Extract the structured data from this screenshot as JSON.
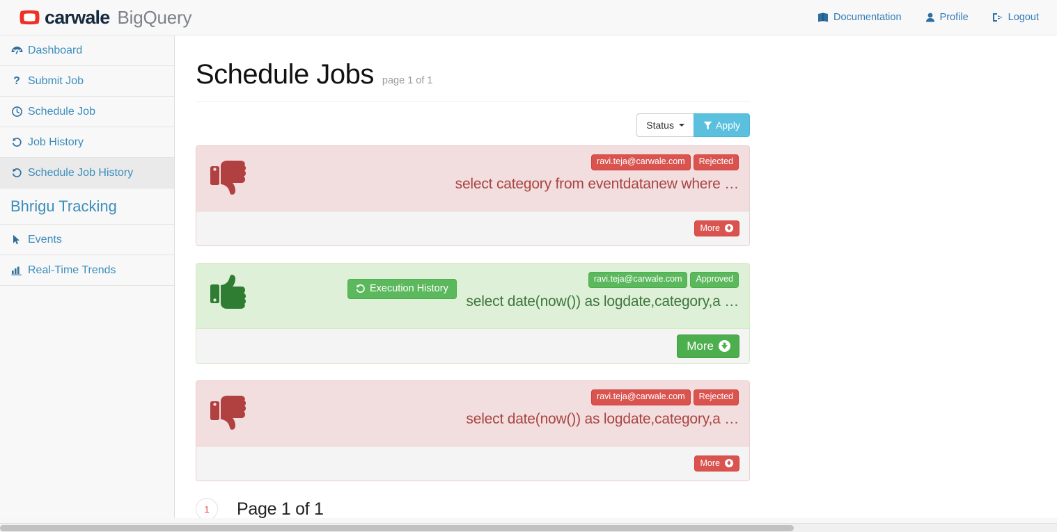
{
  "navbar": {
    "brand_word": "carwale",
    "brand_sub": "BigQuery",
    "logo_icon": "carwale-car-logo",
    "links": [
      {
        "label": "Documentation",
        "icon": "book-icon"
      },
      {
        "label": "Profile",
        "icon": "user-icon"
      },
      {
        "label": "Logout",
        "icon": "sign-out-icon"
      }
    ]
  },
  "sidebar": {
    "items": [
      {
        "label": "Dashboard",
        "icon": "dashboard-icon",
        "active": false
      },
      {
        "label": "Submit Job",
        "icon": "question-icon",
        "active": false
      },
      {
        "label": "Schedule Job",
        "icon": "clock-icon",
        "active": false
      },
      {
        "label": "Job History",
        "icon": "history-icon",
        "active": false
      },
      {
        "label": "Schedule Job History",
        "icon": "history-icon",
        "active": true
      }
    ],
    "section_heading": "Bhrigu Tracking",
    "tracking_items": [
      {
        "label": "Events",
        "icon": "cursor-icon"
      },
      {
        "label": "Real-Time Trends",
        "icon": "bar-chart-icon"
      }
    ]
  },
  "main": {
    "title": "Schedule Jobs",
    "subtitle": "page 1 of 1",
    "filter": {
      "status_label": "Status",
      "apply_label": "Apply",
      "filter_icon": "funnel-icon",
      "caret_icon": "caret-down-icon"
    },
    "cards": [
      {
        "status": "Rejected",
        "theme": "red",
        "thumb_icon": "thumbs-down-icon",
        "owner": "ravi.teja@carwale.com",
        "query": "select category from eventdatanew where …",
        "more_label": "More",
        "more_icon": "arrow-circle-down-icon",
        "has_execution_history": false,
        "execution_history_label": "",
        "execution_history_icon": ""
      },
      {
        "status": "Approved",
        "theme": "green",
        "thumb_icon": "thumbs-up-icon",
        "owner": "ravi.teja@carwale.com",
        "query": "select date(now()) as logdate,category,a …",
        "more_label": "More",
        "more_icon": "arrow-circle-down-icon",
        "has_execution_history": true,
        "execution_history_label": "Execution History",
        "execution_history_icon": "history-icon"
      },
      {
        "status": "Rejected",
        "theme": "red",
        "thumb_icon": "thumbs-down-icon",
        "owner": "ravi.teja@carwale.com",
        "query": "select date(now()) as logdate,category,a …",
        "more_label": "More",
        "more_icon": "arrow-circle-down-icon",
        "has_execution_history": false,
        "execution_history_label": "",
        "execution_history_icon": ""
      }
    ],
    "pagination": {
      "current_page": "1",
      "label": "Page 1 of 1"
    }
  },
  "colors": {
    "brand_red": "#ee3124",
    "brand_navy": "#16293f",
    "link_blue": "#337ab7",
    "sidebar_blue": "#3c8dbc",
    "danger": "#d9534f",
    "success": "#5cb85c",
    "info": "#5bc0de",
    "danger_bg": "#f2dede",
    "success_bg": "#dff0d8",
    "danger_text": "#a94442",
    "success_text": "#3c763d",
    "page_num": "#e8423f"
  }
}
